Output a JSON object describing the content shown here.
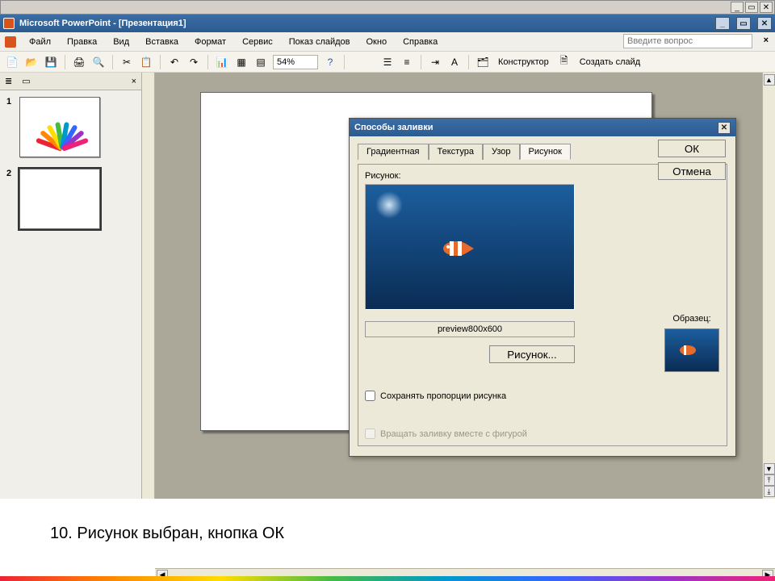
{
  "window": {
    "title": "Microsoft PowerPoint - [Презентация1]"
  },
  "menu": {
    "items": [
      "Файл",
      "Правка",
      "Вид",
      "Вставка",
      "Формат",
      "Сервис",
      "Показ слайдов",
      "Окно",
      "Справка"
    ],
    "ask_placeholder": "Введите вопрос"
  },
  "toolbar": {
    "zoom": "54%",
    "konstruktor": "Конструктор",
    "new_slide": "Создать слайд"
  },
  "outline": {
    "tab_outline_icon": "≣",
    "tab_slides_icon": "▭",
    "slides": [
      {
        "num": "1",
        "selected": false
      },
      {
        "num": "2",
        "selected": true
      }
    ]
  },
  "dialog": {
    "title": "Способы заливки",
    "tabs": [
      "Градиентная",
      "Текстура",
      "Узор",
      "Рисунок"
    ],
    "active_tab": "Рисунок",
    "picture_label": "Рисунок:",
    "filename": "preview800x600",
    "choose_btn": "Рисунок...",
    "lock_aspect": "Сохранять пропорции рисунка",
    "rotate_fill": "Вращать заливку вместе с фигурой",
    "ok": "ОК",
    "cancel": "Отмена",
    "sample_label": "Образец:"
  },
  "caption": "10.   Рисунок выбран, кнопка ОК"
}
